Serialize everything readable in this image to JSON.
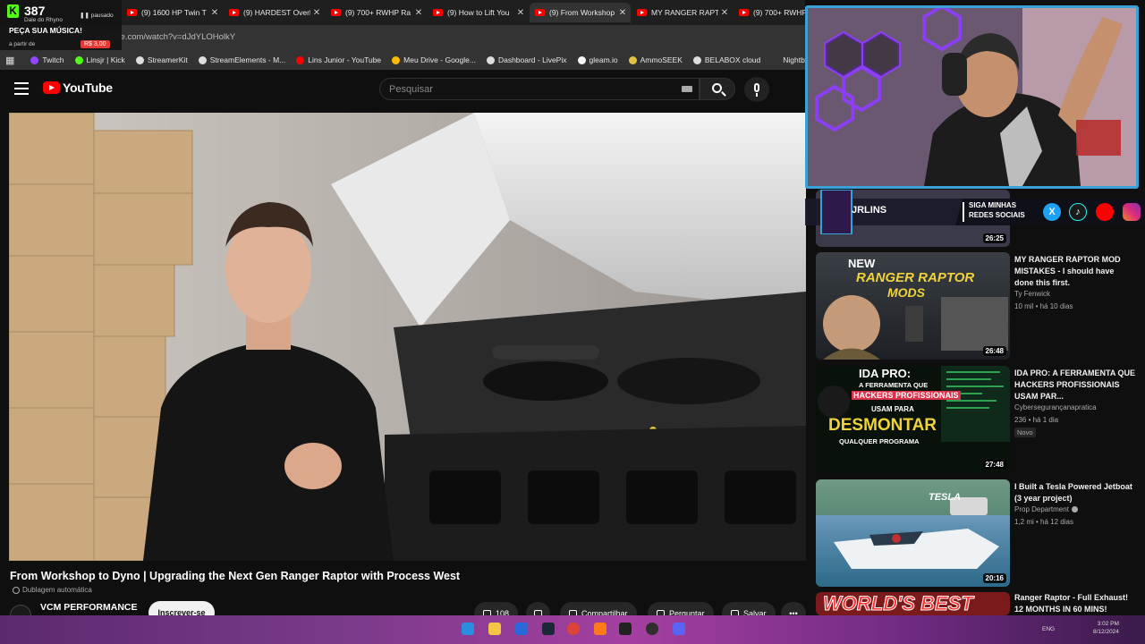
{
  "browser": {
    "tabs": [
      {
        "label": "(9) 1600 HP Twin T"
      },
      {
        "label": "(9) HARDEST Overl"
      },
      {
        "label": "(9) 700+ RWHP Ra"
      },
      {
        "label": "(9) How to Lift You"
      },
      {
        "label": "(9) From Workshop",
        "active": true
      },
      {
        "label": "MY RANGER RAPTO"
      },
      {
        "label": "(9) 700+ RWHP R"
      }
    ],
    "url": "youtube.com/watch?v=dJdYLOHolkY",
    "bookmarks": [
      {
        "label": "Twitch",
        "color": "#9146ff"
      },
      {
        "label": "Linsjr | Kick",
        "color": "#53fc18"
      },
      {
        "label": "StreamerKit",
        "color": "#dddddd"
      },
      {
        "label": "StreamElements - M...",
        "color": "#dddddd"
      },
      {
        "label": "Lins Junior - YouTube",
        "color": "#ff0000"
      },
      {
        "label": "Meu Drive - Google...",
        "color": "#fbbc04"
      },
      {
        "label": "Dashboard - LivePix",
        "color": "#dddddd"
      },
      {
        "label": "gleam.io",
        "color": "#f5f5f5"
      },
      {
        "label": "AmmoSEEK",
        "color": "#e0c040"
      },
      {
        "label": "BELABOX cloud",
        "color": "#dddddd"
      },
      {
        "label": "Nightbot - Comm",
        "color": "#333333"
      }
    ]
  },
  "kick_widget": {
    "count": "387",
    "user": "Dale do Rhyno",
    "status": "pausado",
    "song_prompt": "PEÇA SUA MÚSICA!",
    "from": "a partir de",
    "price": "R$ 3,00"
  },
  "youtube": {
    "logo_text": "YouTube",
    "search_placeholder": "Pesquisar"
  },
  "video": {
    "title": "From Workshop to Dyno | Upgrading the Next Gen Ranger Raptor with Process West",
    "dubbing": "Dublagem automática",
    "channel": "VCM PERFORMANCE",
    "subscribe": "Inscrever-se",
    "likes": "108",
    "share": "Compartilhar",
    "ask": "Perguntar",
    "save": "Salvar",
    "more": "•••"
  },
  "overlay": {
    "brand": "JRLINS",
    "social_text_1": "SIGA MINHAS",
    "social_text_2": "REDES SOCIAIS"
  },
  "sidebar": {
    "top_partial": {
      "duration": "26:25"
    },
    "videos": [
      {
        "title": "MY RANGER RAPTOR MOD MISTAKES - I should have done this first.",
        "channel": "Ty Fenwick",
        "views": "10 mil",
        "age": "há 10 dias",
        "duration": "26:48",
        "thumb_text_1": "NEW",
        "thumb_text_2": "RANGER RAPTOR",
        "thumb_text_3": "MODS"
      },
      {
        "title": "IDA PRO: A FERRAMENTA QUE HACKERS PROFISSIONAIS USAM PAR...",
        "channel": "Cybersegurançanapratica",
        "views": "236",
        "age": "há 1 dia",
        "badge": "Novo",
        "duration": "27:48",
        "thumb_text_1": "IDA PRO:",
        "thumb_text_2": "A FERRAMENTA QUE",
        "thumb_text_3": "HACKERS PROFISSIONAIS",
        "thumb_text_4": "USAM PARA",
        "thumb_text_5": "DESMONTAR",
        "thumb_text_6": "QUALQUER PROGRAMA"
      },
      {
        "title": "I Built a Tesla Powered Jetboat (3 year project)",
        "channel": "Prop Department",
        "views": "1,2 mi",
        "age": "há 12 dias",
        "duration": "20:16",
        "thumb_text_1": "TESLA"
      },
      {
        "title": "Ranger Raptor - Full Exhaust! 12 MONTHS IN 60 MINS!",
        "thumb_text_1": "WORLD'S BEST"
      }
    ]
  },
  "taskbar": {
    "lang": "ENG",
    "time": "3:02 PM",
    "date": "8/12/2024"
  }
}
